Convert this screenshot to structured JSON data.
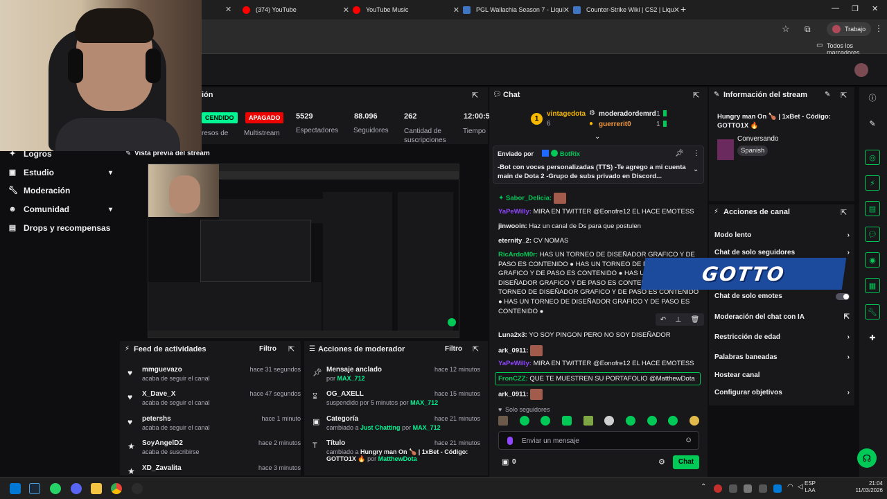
{
  "browser": {
    "tabs": [
      {
        "label": "(374) YouTube",
        "color": "#ff0000"
      },
      {
        "label": "YouTube Music",
        "color": "#ff0000"
      },
      {
        "label": "PGL Wallachia Season 7 - Liqui",
        "color": "#1a3a6b"
      },
      {
        "label": "Counter-Strike Wiki | CS2 | Liqu",
        "color": "#1a3a6b"
      }
    ],
    "profile_label": "Trabajo",
    "bookmarks_label": "Todos los marcadores"
  },
  "stats_panel": {
    "title_fragment": "ión",
    "status_on": "CENDIDO",
    "status_off": "APAGADO",
    "stats": [
      {
        "value": "",
        "label": "resos de"
      },
      {
        "value": "",
        "label": "Multistream"
      },
      {
        "value": "5529",
        "label": "Espectadores"
      },
      {
        "value": "88.096",
        "label": "Seguidores"
      },
      {
        "value": "262",
        "label": "Cantidad de suscripciones"
      },
      {
        "value": "12:00:5",
        "label": "Tiempo en vivo"
      }
    ]
  },
  "left_nav": {
    "items": [
      "Logros",
      "Estudio",
      "Moderación",
      "Comunidad",
      "Drops y recompensas"
    ]
  },
  "preview": {
    "title": "Vista previa del stream"
  },
  "activity_feed": {
    "title": "Feed de actividades",
    "filter": "Filtro",
    "items": [
      {
        "name": "mmguevazo",
        "sub": "acaba de seguir el canal",
        "time": "hace 31 segundos"
      },
      {
        "name": "X_Dave_X",
        "sub": "acaba de seguir el canal",
        "time": "hace 47 segundos"
      },
      {
        "name": "petershs",
        "sub": "acaba de seguir el canal",
        "time": "hace 1 minuto"
      },
      {
        "name": "SoyAngelD2",
        "sub": "acaba de suscribirse",
        "time": "hace 2 minutos"
      },
      {
        "name": "XD_Zavalita",
        "sub": "",
        "time": "hace 3 minutos"
      }
    ]
  },
  "mod_actions": {
    "title": "Acciones de moderador",
    "filter": "Filtro",
    "items": [
      {
        "name": "Mensaje anclado",
        "pre": "por",
        "who": "MAX_712",
        "time": "hace 12 minutos"
      },
      {
        "name": "OG_AXELL",
        "pre": "suspendido por 5 minutos por",
        "who": "MAX_712",
        "time": "hace 15 minutos"
      },
      {
        "name": "Categoría",
        "pre": "cambiado a",
        "mid": "Just Chatting",
        "pre2": "por",
        "who": "MAX_712",
        "time": "hace 21 minutos"
      },
      {
        "name": "Título",
        "pre": "cambiado a",
        "mid": "Hungry man On 🍗 | 1xBet - Código: GOTTO1X 🔥",
        "pre2": "por",
        "who": "MatthewDota",
        "time": "hace 21 minutos"
      }
    ]
  },
  "chat": {
    "title": "Chat",
    "top": [
      {
        "rank": "1",
        "name": "vintagedota",
        "count": "6"
      },
      {
        "name": "moderadordemrd",
        "count": "1"
      },
      {
        "name": "guerrerit0",
        "count": "1"
      }
    ],
    "pinned": {
      "sent_by_label": "Enviado por",
      "sender": "BotRix",
      "text": "-Bot con voces personalizadas (TTS) -Te agrego a mi cuenta main de Dota 2 -Grupo de subs privado en Discord..."
    },
    "messages": [
      {
        "user": "Sabor_Delicia:",
        "color": "#00c957",
        "text": ""
      },
      {
        "user": "YaPeWilly:",
        "color": "#9147ff",
        "text": "MIRA EN TWITTER @Eonofre12 EL HACE EMOTESS"
      },
      {
        "user": "jinwooin:",
        "color": "#ffffff",
        "text": "Haz un canal de Ds para que postulen"
      },
      {
        "user": "eternity_2:",
        "color": "#ffffff",
        "text": "CV NOMAS"
      },
      {
        "user": "RicArdoM0r:",
        "color": "#00c957",
        "text": "HAS UN TORNEO DE DISEÑADOR GRAFICO Y DE PASO ES CONTENIDO ● HAS UN TORNEO DE DISEÑADOR GRAFICO Y DE PASO ES CONTENIDO ● HAS UN TORNEO DE DISEÑADOR GRAFICO Y DE PASO ES CONTENIDO ● HAS UN TORNEO DE DISEÑADOR GRAFICO Y DE PASO ES CONTENIDO ● HAS UN TORNEO DE DISEÑADOR GRAFICO Y DE PASO ES CONTENIDO ●"
      },
      {
        "user": "Luna2x3:",
        "color": "#ffffff",
        "text": "YO SOY PINGON PERO NO SOY DISEÑADOR"
      },
      {
        "user": "ark_0911:",
        "color": "#ffffff",
        "text": ""
      },
      {
        "user": "YaPeWilly:",
        "color": "#9147ff",
        "text": "MIRA EN TWITTER @Eonofre12 EL HACE EMOTESS"
      },
      {
        "user": "FronCZZ:",
        "color": "#00c957",
        "text": "QUE TE MUESTREN SU PORTAFOLIO @MatthewDota"
      },
      {
        "user": "ark_0911:",
        "color": "#ffffff",
        "text": ""
      }
    ],
    "followers_only": "Solo seguidores",
    "input_placeholder": "Enviar un mensaje",
    "points": "0",
    "send_label": "Chat"
  },
  "stream_info": {
    "title": "Información del stream",
    "stream_title": "Hungry man On 🍗 | 1xBet - Código: GOTTO1X 🔥",
    "category": "Conversando",
    "language": "Spanish"
  },
  "channel_actions": {
    "title": "Acciones de canal",
    "items": [
      {
        "label": "Modo lento",
        "type": "arrow"
      },
      {
        "label": "Chat de solo seguidores",
        "type": "arrow"
      },
      {
        "label": "",
        "type": "toggle"
      },
      {
        "label": "Chat de solo emotes",
        "type": "toggle"
      },
      {
        "label": "Moderación del chat con IA",
        "type": "ext"
      },
      {
        "label": "Restricción de edad",
        "type": "arrow"
      },
      {
        "label": "Palabras baneadas",
        "type": "arrow"
      },
      {
        "label": "Hostear canal",
        "type": "none"
      },
      {
        "label": "Configurar objetivos",
        "type": "arrow"
      }
    ]
  },
  "overlay_text": "GOTTO",
  "taskbar": {
    "lang": "ESP",
    "region": "LAA",
    "time": "21:04",
    "date": "11/03/2026"
  }
}
